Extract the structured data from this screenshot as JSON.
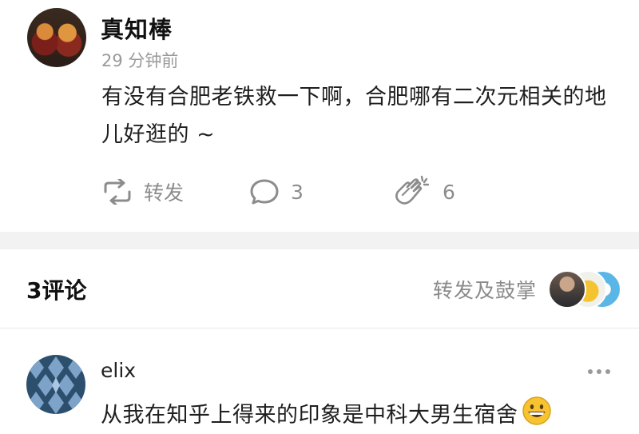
{
  "post": {
    "author": "真知棒",
    "time": "29 分钟前",
    "content": "有没有合肥老铁救一下啊，合肥哪有二次元相关的地儿好逛的 ~",
    "avatar_icon": "food-avatar-icon"
  },
  "actions": {
    "repost_label": "转发",
    "comment_count": "3",
    "clap_count": "6"
  },
  "comments_header": {
    "count_label": "3评论",
    "reposts_label": "转发及鼓掌"
  },
  "comment": {
    "author": "elix",
    "text": "从我在知乎上得来的印象是中科大男生宿舍",
    "emoji": "grinning-emoji-icon"
  },
  "colors": {
    "text": "#1a1a1a",
    "muted": "#8c8c8c",
    "separator": "#f2f2f2",
    "emoji": "#f7c331"
  }
}
